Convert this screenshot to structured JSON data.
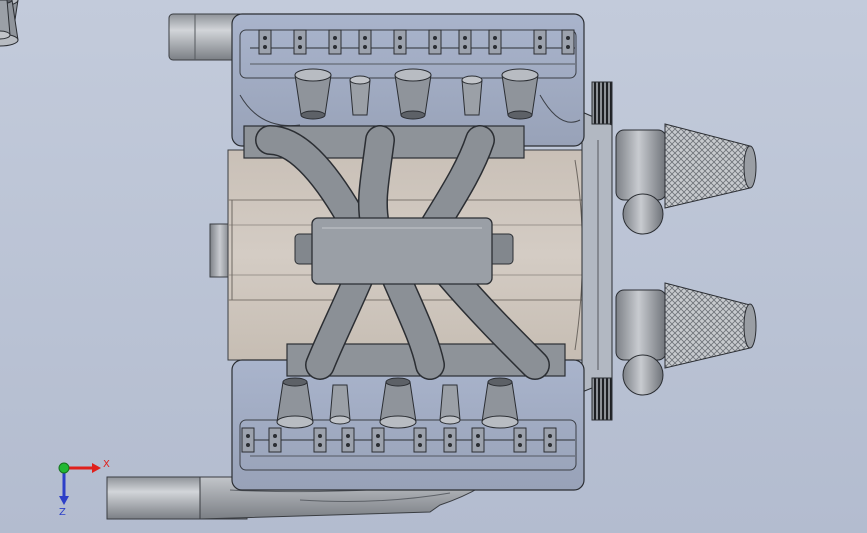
{
  "viewport": {
    "background_top": "#c3cbdb",
    "background_bottom": "#b3bccf"
  },
  "model": {
    "metal_light": "#b8bcc2",
    "metal_mid": "#8e9399",
    "metal_dark": "#5d6167",
    "block_tan": "#cdc4bb",
    "glass_blue": "#aab6cf",
    "edge": "#2b2e33"
  },
  "triad": {
    "x_label": "X",
    "z_label": "Z",
    "x_color": "#e0201b",
    "y_color": "#22b833",
    "z_color": "#2c3fc8"
  }
}
